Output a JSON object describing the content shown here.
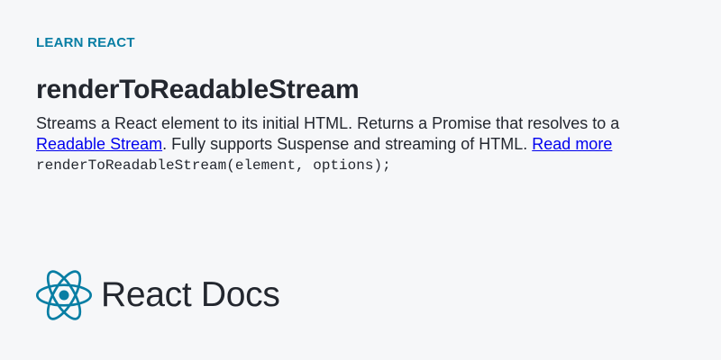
{
  "eyebrow": "LEARN REACT",
  "title": "renderToReadableStream",
  "description": {
    "prefix": "Streams a React element to its initial HTML. Returns a Promise that resolves to a ",
    "link_text": "Readable Stream",
    "middle": ". Fully supports Suspense and streaming of HTML. ",
    "read_more": "Read more"
  },
  "code_signature": "renderToReadableStream(element, options);",
  "brand": {
    "name": "React Docs",
    "logo_icon": "react-logo-icon"
  },
  "colors": {
    "background": "#f6f7f9",
    "accent": "#087ea4",
    "text": "#23272f",
    "link": "#0000ee"
  }
}
